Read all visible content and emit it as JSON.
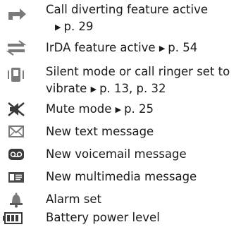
{
  "indicators": [
    {
      "icon": "call-divert-icon",
      "lines": [
        "Call diverting feature active"
      ],
      "ref": "p. 29"
    },
    {
      "icon": "irda-icon",
      "lines": [
        "IrDA feature active"
      ],
      "ref": "p. 54"
    },
    {
      "icon": "vibrate-icon",
      "lines": [
        "Silent mode or call ringer set to",
        "vibrate"
      ],
      "ref": "p. 13, p. 32"
    },
    {
      "icon": "mute-icon",
      "lines": [
        "Mute mode"
      ],
      "ref": "p. 25"
    },
    {
      "icon": "text-message-icon",
      "lines": [
        "New text message"
      ],
      "ref": ""
    },
    {
      "icon": "voicemail-icon",
      "lines": [
        "New voicemail message"
      ],
      "ref": ""
    },
    {
      "icon": "multimedia-message-icon",
      "lines": [
        "New multimedia message"
      ],
      "ref": ""
    },
    {
      "icon": "alarm-icon",
      "lines": [
        "Alarm set"
      ],
      "ref": ""
    },
    {
      "icon": "battery-icon",
      "lines": [
        "Battery power level"
      ],
      "ref": ""
    }
  ],
  "colors": {
    "text": "#1a1a1a",
    "icon": "#7a7a7a",
    "icon_dark": "#3a3a3a"
  }
}
